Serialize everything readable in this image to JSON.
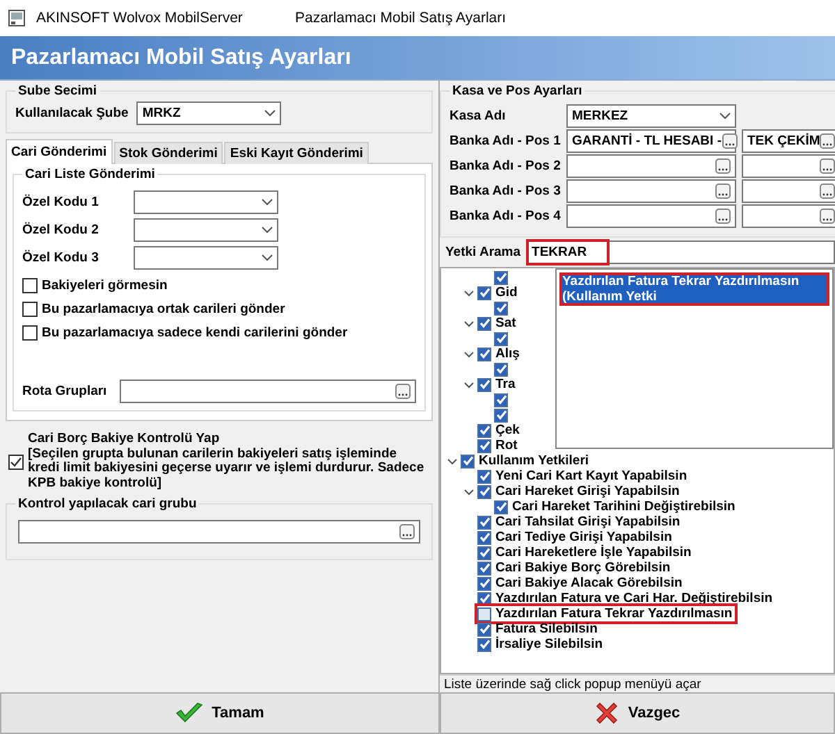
{
  "window": {
    "app_title": "AKINSOFT Wolvox MobilServer",
    "title": "Pazarlamacı Mobil Satış Ayarları"
  },
  "header": {
    "title": "Pazarlamacı Mobil Satış Ayarları"
  },
  "branch": {
    "group_title": "Sube Secimi",
    "label": "Kullanılacak Şube",
    "value": "MRKZ"
  },
  "tabs": [
    {
      "label": "Cari Gönderimi",
      "selected": true
    },
    {
      "label": "Stok Gönderimi",
      "selected": false
    },
    {
      "label": "Eski Kayıt Gönderimi",
      "selected": false
    }
  ],
  "cari_list": {
    "group_title": "Cari Liste Gönderimi",
    "combos": [
      {
        "label": "Özel Kodu 1"
      },
      {
        "label": "Özel Kodu 2"
      },
      {
        "label": "Özel Kodu 3"
      }
    ],
    "checkboxes": [
      {
        "label": "Bakiyeleri görmesin",
        "checked": false
      },
      {
        "label": "Bu pazarlamacıya ortak carileri gönder",
        "checked": false
      },
      {
        "label": "Bu pazarlamacıya sadece kendi carilerini gönder",
        "checked": false
      }
    ],
    "route_label": "Rota Grupları"
  },
  "balance_check": {
    "label": "Cari Borç Bakiye Kontrolü Yap",
    "note": "[Seçilen grupta bulunan carilerin bakiyeleri satış işleminde kredi limit bakiyesini geçerse uyarır ve işlemi durdurur. Sadece KPB bakiye kontrolü]",
    "checked": true
  },
  "control_group": {
    "group_title": "Kontrol yapılacak cari grubu"
  },
  "pos": {
    "group_title": "Kasa ve Pos Ayarları",
    "cash_label": "Kasa Adı",
    "cash_value": "MERKEZ",
    "banks": [
      {
        "label": "Banka Adı - Pos 1",
        "bank": "GARANTİ - TL HESABI -",
        "type": "TEK ÇEKİM"
      },
      {
        "label": "Banka Adı - Pos 2"
      },
      {
        "label": "Banka Adı - Pos 3"
      },
      {
        "label": "Banka Adı - Pos 4"
      }
    ]
  },
  "permission_search": {
    "label": "Yetki Arama",
    "value": "TEKRAR",
    "highlighted": true
  },
  "tree": {
    "top_children": [
      {
        "checked": true
      }
    ],
    "group": [
      {
        "label": "Gid",
        "checked": true,
        "expanded": true,
        "children": [
          {
            "checked": true
          }
        ]
      },
      {
        "label": "Sat",
        "checked": true,
        "expanded": true,
        "children": [
          {
            "checked": true
          }
        ]
      },
      {
        "label": "Alış",
        "checked": true,
        "expanded": true,
        "children": [
          {
            "checked": true
          }
        ]
      },
      {
        "label": "Tra",
        "checked": true,
        "expanded": true,
        "children": [
          {
            "checked": true
          },
          {
            "checked": true
          }
        ]
      },
      {
        "label": "Çek",
        "checked": true
      },
      {
        "label": "Rot",
        "checked": true
      }
    ],
    "items": [
      {
        "label": "Kullanım Yetkileri",
        "checked": true,
        "expanded": true,
        "children": [
          {
            "label": "Yeni Cari Kart Kayıt Yapabilsin",
            "checked": true
          },
          {
            "label": "Cari Hareket Girişi Yapabilsin",
            "checked": true,
            "expanded": true,
            "children": [
              {
                "label": "Cari Hareket Tarihini Değiştirebilsin",
                "checked": true
              }
            ]
          },
          {
            "label": "Cari Tahsilat Girişi Yapabilsin",
            "checked": true
          },
          {
            "label": "Cari Tediye Girişi Yapabilsin",
            "checked": true
          },
          {
            "label": "Cari Hareketlere İşle Yapabilsin",
            "checked": true
          },
          {
            "label": "Cari Bakiye Borç Görebilsin",
            "checked": true
          },
          {
            "label": "Cari Bakiye Alacak Görebilsin",
            "checked": true
          },
          {
            "label": "Yazdırılan Fatura ve Cari Har. Değiştirebilsin",
            "checked": true
          },
          {
            "label": "Yazdırılan Fatura Tekrar Yazdırılmasın",
            "checked": false,
            "highlighted": true
          },
          {
            "label": "Fatura Silebilsin",
            "checked": true
          },
          {
            "label": "İrsaliye Silebilsin",
            "checked": true
          }
        ]
      }
    ]
  },
  "popup": {
    "items": [
      {
        "label": "Yazdırılan Fatura Tekrar Yazdırılmasın (Kullanım Yetki",
        "selected": true
      }
    ]
  },
  "status": "Liste üzerinde sağ click popup menüyü açar",
  "buttons": [
    {
      "kind": "ok",
      "label": "Tamam"
    },
    {
      "kind": "cancel",
      "label": "Vazgec"
    }
  ]
}
